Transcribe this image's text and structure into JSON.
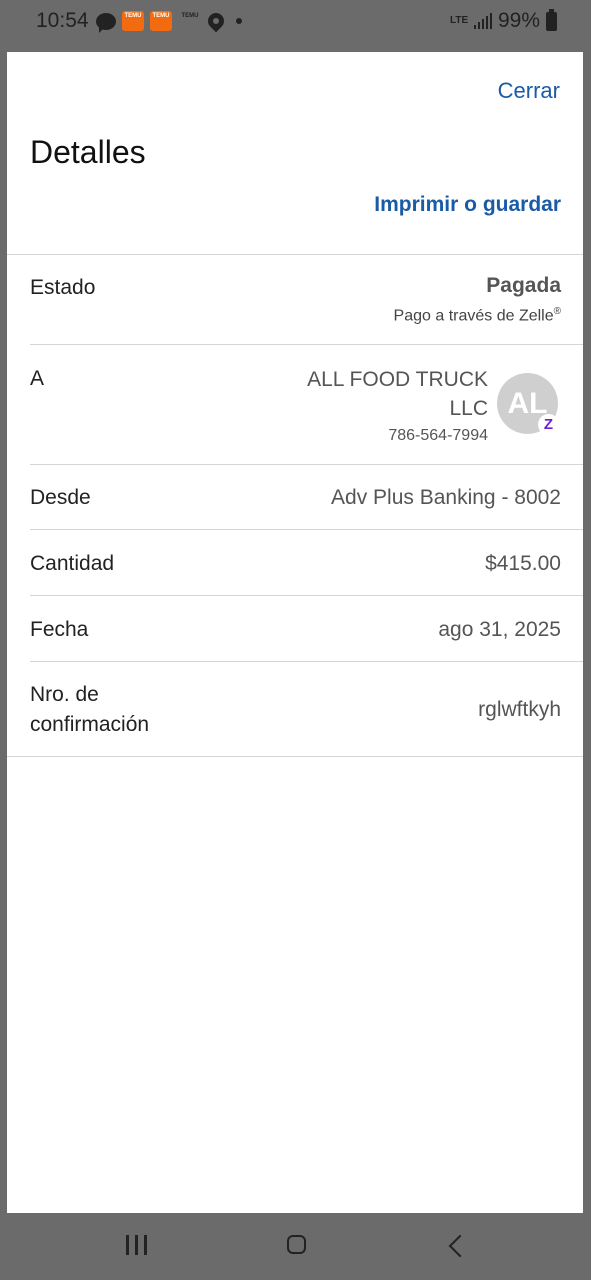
{
  "status_bar": {
    "time": "10:54",
    "temu_label": "TEMU",
    "network": "LTE",
    "battery": "99%"
  },
  "header": {
    "close": "Cerrar",
    "title": "Detalles",
    "print": "Imprimir o guardar"
  },
  "details": {
    "status": {
      "label": "Estado",
      "value": "Pagada",
      "sub": "Pago a través de Zelle",
      "sub_mark": "®"
    },
    "to": {
      "label": "A",
      "name_line1": "ALL FOOD TRUCK",
      "name_line2": "LLC",
      "phone": "786-564-7994",
      "avatar_initials": "AL",
      "badge": "Z"
    },
    "from": {
      "label": "Desde",
      "value": "Adv Plus Banking - 8002"
    },
    "amount": {
      "label": "Cantidad",
      "value": "$415.00"
    },
    "date": {
      "label": "Fecha",
      "value": "ago 31, 2025"
    },
    "confirmation": {
      "label_line1": "Nro. de",
      "label_line2": "confirmación",
      "value": "rglwftkyh"
    }
  },
  "colors": {
    "link": "#1a5ba6",
    "zelle": "#6d1ed4"
  }
}
